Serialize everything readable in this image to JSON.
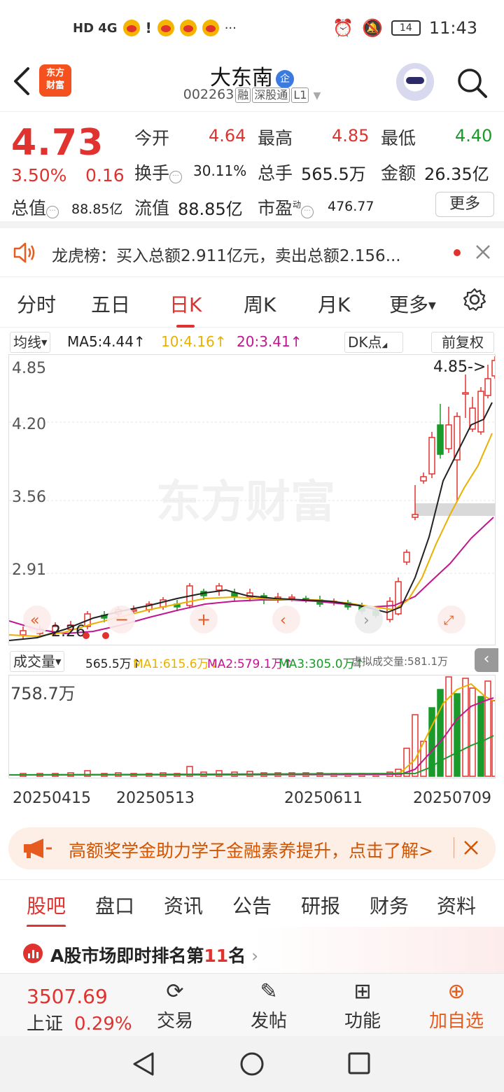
{
  "status": {
    "network": "HD 4G",
    "time": "11:43",
    "battery": "14",
    "more": "···"
  },
  "header": {
    "logo": "东方财富",
    "title": "大东南",
    "title_badge": "企",
    "code": "002263",
    "tags": [
      "融",
      "深股通",
      "L1"
    ]
  },
  "quote": {
    "price": "4.73",
    "change_pct": "3.50%",
    "change_amt": "0.16",
    "open_label": "今开",
    "open": "4.64",
    "high_label": "最高",
    "high": "4.85",
    "low_label": "最低",
    "low": "4.40",
    "turnover_label": "换手",
    "turnover": "30.11%",
    "volume_label": "总手",
    "volume": "565.5万",
    "amount_label": "金额",
    "amount": "26.35亿",
    "mktcap_label": "总值",
    "mktcap": "88.85亿",
    "float_label": "流值",
    "float": "88.85亿",
    "pe_label": "市盈",
    "pe_sup": "动",
    "pe": "476.77",
    "more": "更多"
  },
  "notice": {
    "text": "龙虎榜：买入总额2.911亿元，卖出总额2.156..."
  },
  "tabs": [
    "分时",
    "五日",
    "日K",
    "周K",
    "月K",
    "更多"
  ],
  "ma_row": {
    "select": "均线",
    "ma5": "MA5:4.44↑",
    "ma10": "10:4.16↑",
    "ma20": "20:3.41↑",
    "dk": "DK点",
    "adjust": "前复权"
  },
  "chart": {
    "y_ticks": [
      "4.85",
      "4.20",
      "3.56",
      "2.91"
    ],
    "max_marker": "4.85->",
    "min_marker": "2.26",
    "watermark": "东方财富"
  },
  "vol_row": {
    "select": "成交量",
    "vol": "565.5万↑",
    "ma1": "MA1:615.6万↓",
    "ma2": "MA2:579.1万↑",
    "ma3": "MA3:305.0万↑",
    "virtual": "虚拟成交量:581.1万"
  },
  "vol_chart": {
    "y_tick": "758.7万"
  },
  "dates": [
    "20250415",
    "20250513",
    "20250611",
    "20250709"
  ],
  "promo": {
    "text": "高额奖学金助力学子金融素养提升，点击了解>"
  },
  "bottom_tabs": [
    "股吧",
    "盘口",
    "资讯",
    "公告",
    "研报",
    "财务",
    "资料"
  ],
  "rank": {
    "prefix": "A股市场即时排名第",
    "num": "11",
    "suffix": "名"
  },
  "bnav": {
    "index_value": "3507.69",
    "index_name": "上证",
    "index_pct": "0.29%",
    "items": [
      "交易",
      "发帖",
      "功能",
      "加自选"
    ]
  },
  "colors": {
    "up": "#e0322f",
    "down": "#1a9a2a",
    "accent": "#f4511e"
  },
  "chart_data": {
    "type": "candlestick",
    "y_range": [
      2.26,
      4.85
    ],
    "ma_series": [
      "MA5",
      "MA10",
      "MA20"
    ]
  }
}
